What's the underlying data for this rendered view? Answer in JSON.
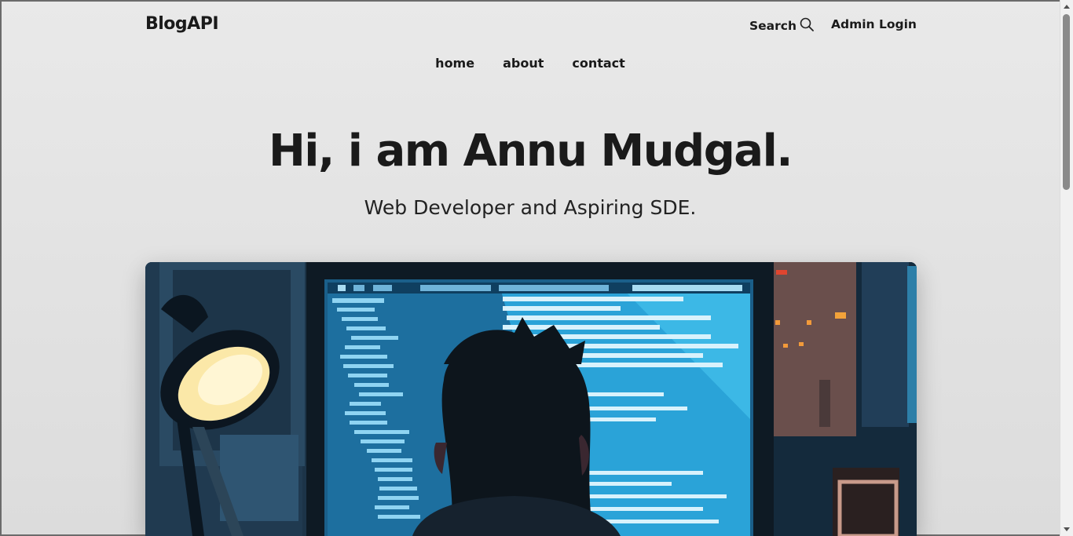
{
  "header": {
    "brand": "BlogAPI",
    "search_label": "Search",
    "admin_label": "Admin Login"
  },
  "nav": {
    "items": [
      {
        "label": "home"
      },
      {
        "label": "about"
      },
      {
        "label": "contact"
      }
    ]
  },
  "hero": {
    "title": "Hi, i am Annu Mudgal.",
    "subtitle": "Web Developer and Aspiring SDE."
  },
  "icons": {
    "search": "search-icon"
  },
  "colors": {
    "text": "#1a1a1a",
    "background": "#e5e5e5",
    "screen": "#2a9bd6",
    "room": "#1c3a52"
  }
}
